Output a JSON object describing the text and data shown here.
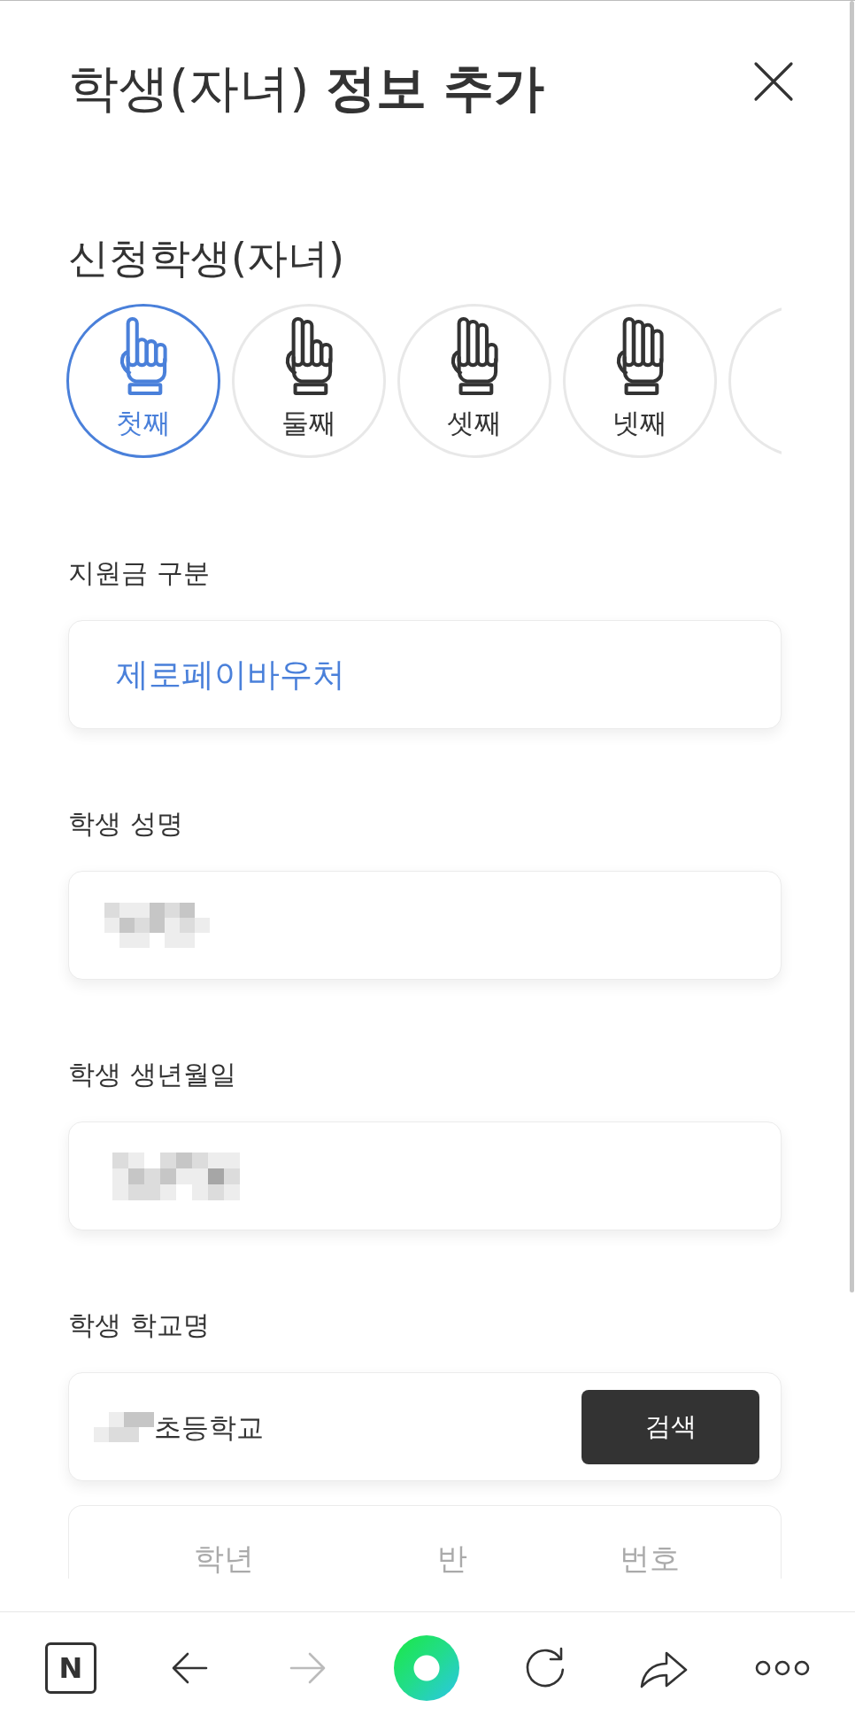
{
  "header": {
    "title": "학생(자녀) **정보 추가**"
  },
  "children_section": {
    "title": "신청학생(자녀)",
    "options": [
      {
        "label": "첫째",
        "selected": true
      },
      {
        "label": "둘째",
        "selected": false
      },
      {
        "label": "셋째",
        "selected": false
      },
      {
        "label": "넷째",
        "selected": false
      },
      {
        "selected": false
      }
    ]
  },
  "fields": [
    {
      "kind": "select",
      "label": "지원금 구분",
      "value": "제로페이바우처"
    },
    {
      "kind": "redacted",
      "label": "학생 성명"
    },
    {
      "kind": "redacted",
      "label": "학생 생년월일"
    },
    {
      "kind": "search",
      "label": "학생 학교명",
      "value": "초등학교",
      "redacted_prefix": true,
      "button": "검색"
    }
  ],
  "class_fields": [
    {
      "placeholder": "학년"
    },
    {
      "placeholder": "반"
    },
    {
      "placeholder": "번호"
    }
  ],
  "bottom_bar": [
    {
      "kind": "logo",
      "label": "N",
      "disabled": false
    },
    {
      "kind": "back",
      "disabled": false
    },
    {
      "kind": "forward",
      "disabled": true
    },
    {
      "kind": "orb",
      "disabled": false
    },
    {
      "kind": "reload",
      "disabled": false
    },
    {
      "kind": "share",
      "disabled": false
    },
    {
      "kind": "more",
      "disabled": false
    }
  ]
}
